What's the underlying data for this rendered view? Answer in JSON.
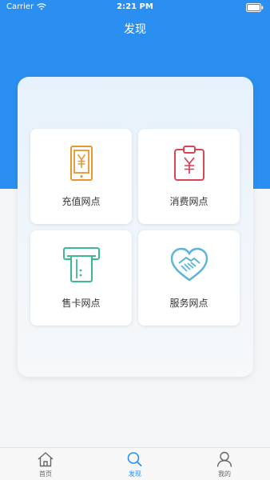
{
  "status_bar": {
    "carrier": "Carrier",
    "time": "2:21 PM"
  },
  "nav": {
    "title": "发现"
  },
  "tiles": [
    {
      "label": "充值网点",
      "icon": "phone-yuan-icon",
      "color": "#e8962e"
    },
    {
      "label": "消费网点",
      "icon": "clipboard-yuan-icon",
      "color": "#d9465a"
    },
    {
      "label": "售卡网点",
      "icon": "card-dispenser-icon",
      "color": "#3cba8c"
    },
    {
      "label": "服务网点",
      "icon": "handshake-heart-icon",
      "color": "#5bb3d6"
    }
  ],
  "tabbar": {
    "items": [
      {
        "label": "首页",
        "icon": "home-icon",
        "active": false
      },
      {
        "label": "发现",
        "icon": "search-icon",
        "active": true
      },
      {
        "label": "我的",
        "icon": "user-icon",
        "active": false
      }
    ]
  },
  "colors": {
    "primary": "#2a8ff0"
  }
}
